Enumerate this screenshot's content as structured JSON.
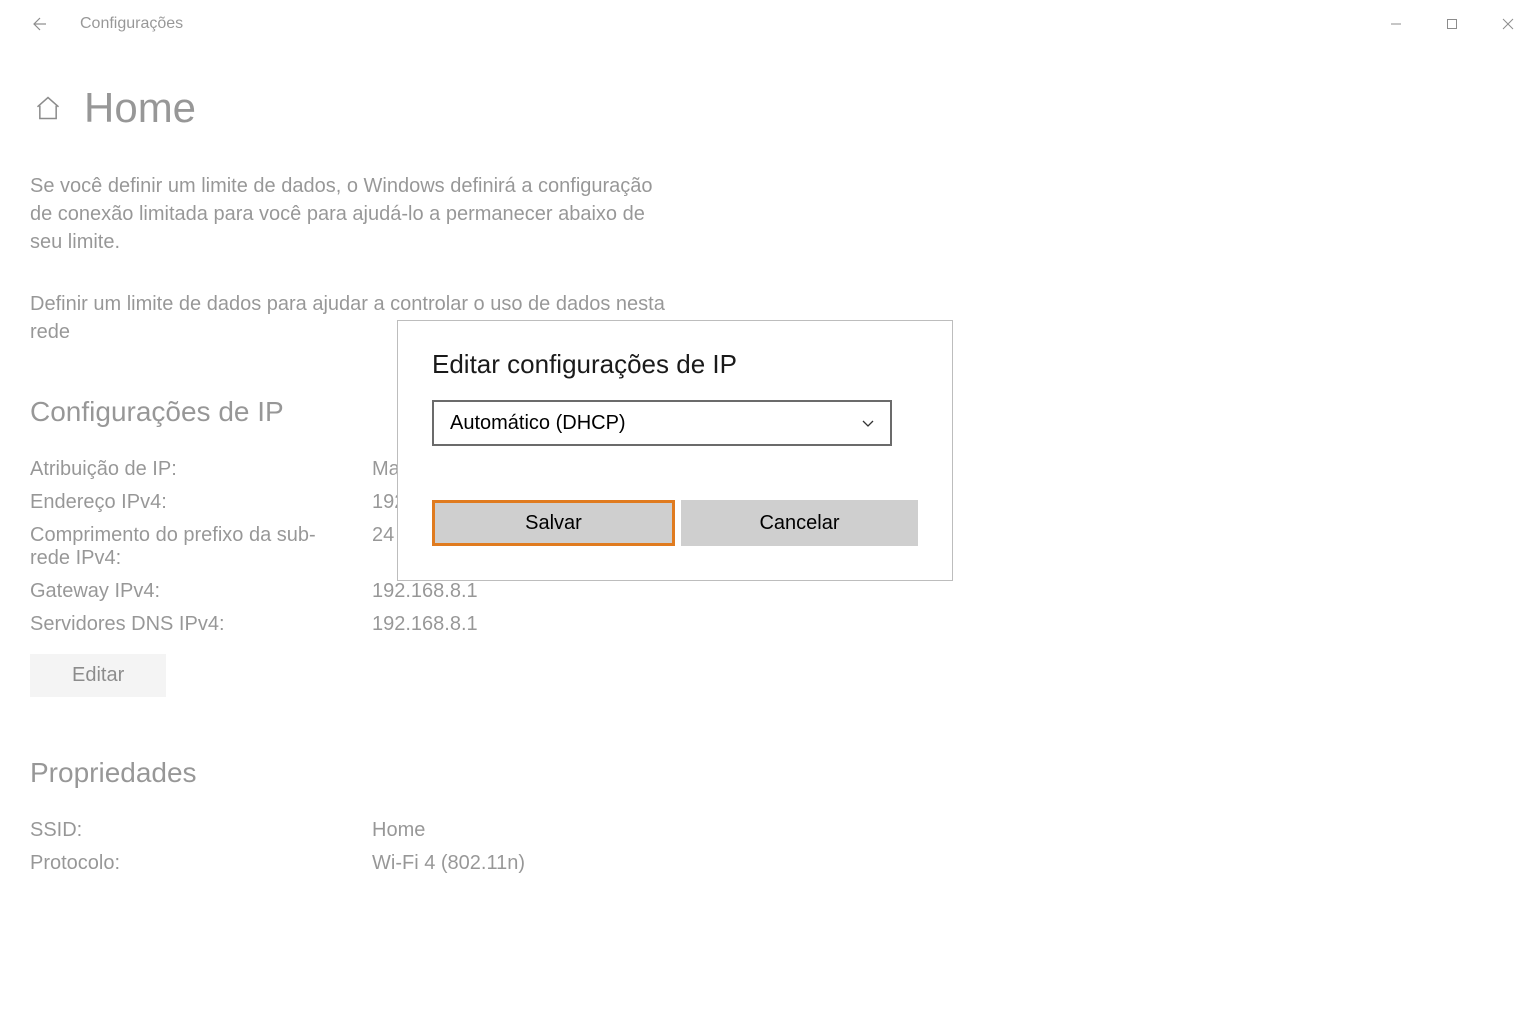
{
  "window": {
    "title": "Configurações"
  },
  "page": {
    "heading": "Home",
    "description": "Se você definir um limite de dados, o Windows definirá a configuração de conexão limitada para você para ajudá-lo a permanecer abaixo de seu limite.",
    "limit_link": "Definir um limite de dados para ajudar a controlar o uso de dados nesta rede"
  },
  "ip_section": {
    "heading": "Configurações de IP",
    "rows": [
      {
        "label": "Atribuição de IP:",
        "value": "Ma"
      },
      {
        "label": "Endereço IPv4:",
        "value": "192"
      },
      {
        "label": "Comprimento do prefixo da sub-rede IPv4:",
        "value": "24"
      },
      {
        "label": "Gateway IPv4:",
        "value": "192.168.8.1"
      },
      {
        "label": "Servidores DNS IPv4:",
        "value": "192.168.8.1"
      }
    ],
    "edit_label": "Editar"
  },
  "properties_section": {
    "heading": "Propriedades",
    "rows": [
      {
        "label": "SSID:",
        "value": "Home"
      },
      {
        "label": "Protocolo:",
        "value": "Wi-Fi 4 (802.11n)"
      }
    ]
  },
  "dialog": {
    "title": "Editar configurações de IP",
    "dropdown_value": "Automático (DHCP)",
    "save_label": "Salvar",
    "cancel_label": "Cancelar"
  }
}
